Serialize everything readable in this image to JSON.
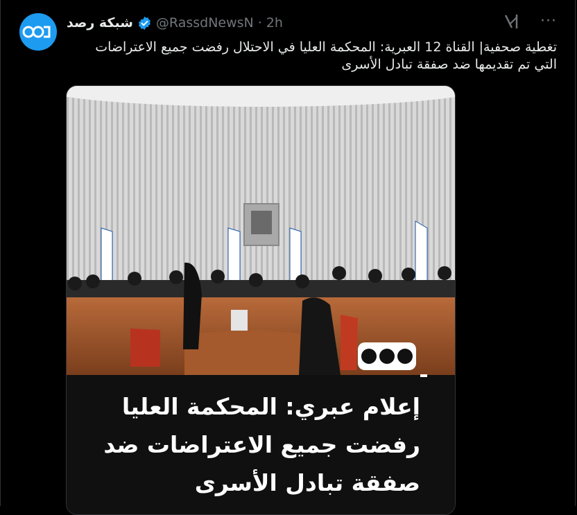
{
  "tweet": {
    "display_name": "شبكة رصد",
    "handle": "@RassdNewsN",
    "separator": "·",
    "time": "2h",
    "body": "تغطية صحفية| القناة 12 العبرية: المحكمة العليا في الاحتلال رفضت جميع الاعتراضات التي تم تقديمها ضد صفقة تبادل الأسرى",
    "more_label": "···"
  },
  "media": {
    "overlay_title": "إعلام عبري: المحكمة العليا رفضت جميع الاعتراضات ضد صفقة تبادل الأسرى"
  },
  "colors": {
    "avatar_bg": "#1d9bf0",
    "verified": "#1d9bf0"
  }
}
